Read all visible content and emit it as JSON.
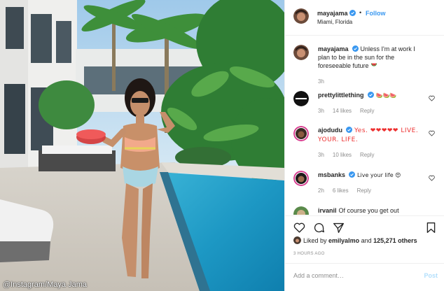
{
  "photo": {
    "alt_scene": "pool",
    "credit": "@Instagram/Maya Jama"
  },
  "header": {
    "username": "mayajama",
    "separator": "•",
    "follow_label": "Follow",
    "location": "Miami, Florida",
    "verified_icon": "verified-badge-icon"
  },
  "caption": {
    "username": "mayajama",
    "text": "Unless I'm at work I plan to be in the sun for the foreseeable future",
    "emoji": "watermelon-icon",
    "time": "3h"
  },
  "comments": [
    {
      "username": "prettylittlething",
      "verified": true,
      "text": "🍉🍉🍉",
      "time": "3h",
      "likes": "14 likes",
      "reply": "Reply"
    },
    {
      "username": "ajodudu",
      "verified": true,
      "text": "Yes. ❤❤❤❤❤ LIVE. YOUR. LIFE.",
      "time": "3h",
      "likes": "10 likes",
      "reply": "Reply"
    },
    {
      "username": "msbanks",
      "verified": true,
      "text": "Live your life 😍",
      "time": "2h",
      "likes": "6 likes",
      "reply": "Reply"
    },
    {
      "username": "irvanil",
      "verified": false,
      "text": "Of course you get out",
      "time": "",
      "likes": "",
      "reply": ""
    }
  ],
  "likes_line": {
    "prefix": "Liked by",
    "user": "emilyalmo",
    "joiner": "and",
    "count": "125,271 others"
  },
  "timestamp": "3 HOURS AGO",
  "add_comment": {
    "placeholder": "Add a comment…",
    "post_label": "Post"
  },
  "colors": {
    "link_blue": "#3897f0",
    "post_disabled": "#b2dffc",
    "verified_blue": "#3897f0",
    "muted": "#8e8e8e"
  }
}
